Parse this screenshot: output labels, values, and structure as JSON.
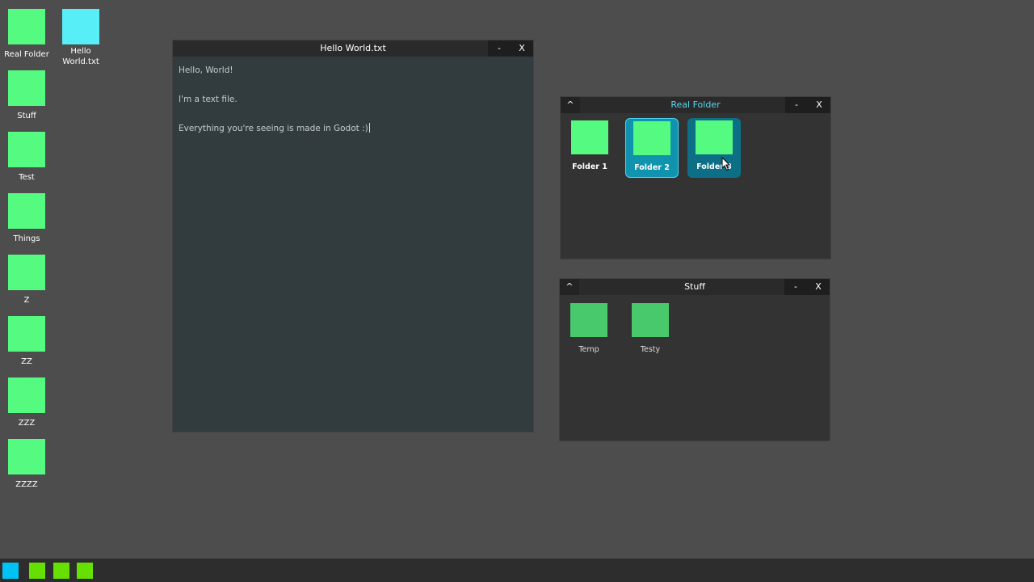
{
  "desktop": {
    "icons": [
      {
        "label": "Real Folder",
        "type": "folder"
      },
      {
        "label": "Stuff",
        "type": "folder"
      },
      {
        "label": "Test",
        "type": "folder"
      },
      {
        "label": "Things",
        "type": "folder"
      },
      {
        "label": "Z",
        "type": "folder"
      },
      {
        "label": "ZZ",
        "type": "folder"
      },
      {
        "label": "ZZZ",
        "type": "folder"
      },
      {
        "label": "ZZZZ",
        "type": "folder"
      },
      {
        "label": "Hello\nWorld.txt",
        "type": "text-file"
      }
    ]
  },
  "text_window": {
    "title": "Hello World.txt",
    "minimize_label": "-",
    "close_label": "X",
    "lines": [
      "Hello, World!",
      "I'm a text file.",
      "Everything you're seeing is made in Godot :)"
    ]
  },
  "real_folder_window": {
    "up_label": "^",
    "title": "Real Folder",
    "minimize_label": "-",
    "close_label": "X",
    "items": [
      {
        "label": "Folder 1",
        "state": "normal"
      },
      {
        "label": "Folder 2",
        "state": "selected"
      },
      {
        "label": "Folder 3",
        "state": "hovered"
      }
    ]
  },
  "stuff_window": {
    "up_label": "^",
    "title": "Stuff",
    "minimize_label": "-",
    "close_label": "X",
    "items": [
      {
        "label": "Temp"
      },
      {
        "label": "Testy"
      }
    ]
  },
  "taskbar": {
    "buttons": [
      {
        "name": "start-button",
        "color": "#00c3f5"
      },
      {
        "name": "task-button-1",
        "color": "#66e000"
      },
      {
        "name": "task-button-2",
        "color": "#66e000"
      },
      {
        "name": "task-button-3",
        "color": "#66e000"
      }
    ]
  },
  "colors": {
    "desktop_bg": "#4d4d4d",
    "folder_green": "#55fa80",
    "file_cyan": "#57eef8",
    "selection_blue": "#0f93ae",
    "title_accent": "#57d9f0"
  }
}
